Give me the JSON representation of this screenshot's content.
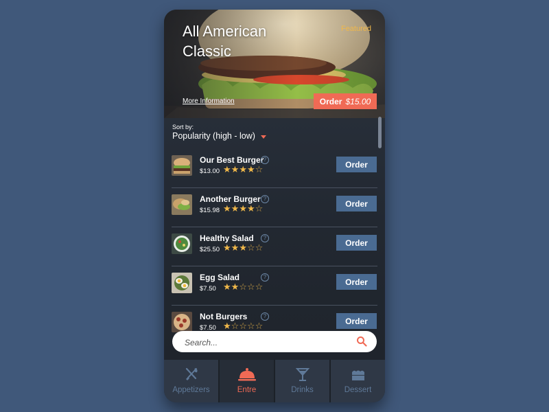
{
  "hero": {
    "title": "All American Classic",
    "badge": "Featured",
    "more_info": "More Information",
    "order_label": "Order",
    "order_price": "$15.00"
  },
  "sort": {
    "label": "Sort by:",
    "value": "Popularity (high - low)"
  },
  "items": [
    {
      "name": "Our Best Burger",
      "price": "$13.00",
      "rating": 4,
      "order_label": "Order",
      "thumb": "burger-photo"
    },
    {
      "name": "Another Burger",
      "price": "$15.98",
      "rating": 4,
      "order_label": "Order",
      "thumb": "burger-photo"
    },
    {
      "name": "Healthy Salad",
      "price": "$25.50",
      "rating": 3,
      "order_label": "Order",
      "thumb": "salad-photo"
    },
    {
      "name": "Egg Salad",
      "price": "$7.50",
      "rating": 2,
      "order_label": "Order",
      "thumb": "egg-salad-photo"
    },
    {
      "name": "Not Burgers",
      "price": "$7.50",
      "rating": 1,
      "order_label": "Order",
      "thumb": "pizza-photo"
    }
  ],
  "rating_max": 5,
  "search": {
    "placeholder": "Search..."
  },
  "tabs": [
    {
      "label": "Appetizers",
      "icon": "utensils-icon",
      "active": false
    },
    {
      "label": "Entre",
      "icon": "cloche-icon",
      "active": true
    },
    {
      "label": "Drinks",
      "icon": "cocktail-icon",
      "active": false
    },
    {
      "label": "Dessert",
      "icon": "cake-icon",
      "active": false
    }
  ],
  "colors": {
    "background": "#40587a",
    "accent": "#f06a55",
    "button": "#4a6b92",
    "star": "#f0b84a",
    "featured": "#f0b84a",
    "inactive_tab": "#5f7998"
  }
}
